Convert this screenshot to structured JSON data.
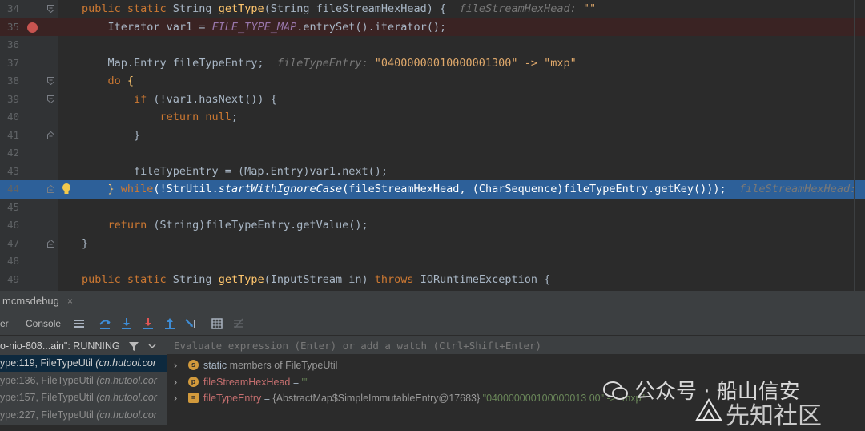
{
  "editor": {
    "lines": [
      {
        "num": "34",
        "parts": [
          [
            "kw",
            "public static "
          ],
          [
            "",
            "String "
          ],
          [
            "fn",
            "getType"
          ],
          [
            "",
            "(String fileStreamHexHead) {  "
          ],
          [
            "hint",
            "fileStreamHexHead: "
          ],
          [
            "hstr",
            "\"\""
          ]
        ]
      },
      {
        "num": "35",
        "parts": [
          [
            "",
            "Iterator var1 = "
          ],
          [
            "st",
            "FILE_TYPE_MAP"
          ],
          [
            "",
            ".entrySet().iterator();"
          ]
        ]
      },
      {
        "num": "36",
        "parts": []
      },
      {
        "num": "37",
        "parts": [
          [
            "",
            "Map.Entry fileTypeEntry;  "
          ],
          [
            "hint",
            "fileTypeEntry: "
          ],
          [
            "hstr",
            "\"04000000010000001300\" -> \"mxp\""
          ]
        ]
      },
      {
        "num": "38",
        "parts": [
          [
            "kw",
            "do "
          ],
          [
            "fn",
            "{"
          ]
        ]
      },
      {
        "num": "39",
        "parts": [
          [
            "kw",
            "if "
          ],
          [
            "",
            "(!var1.hasNext()) {"
          ]
        ]
      },
      {
        "num": "40",
        "parts": [
          [
            "kw",
            "return null"
          ],
          [
            "",
            ";"
          ]
        ]
      },
      {
        "num": "41",
        "parts": [
          [
            "",
            "}"
          ]
        ]
      },
      {
        "num": "42",
        "parts": []
      },
      {
        "num": "43",
        "parts": [
          [
            "",
            "fileTypeEntry = (Map.Entry)var1.next();"
          ]
        ]
      },
      {
        "num": "44",
        "parts": [
          [
            "fn",
            "}"
          ],
          [
            "",
            " "
          ],
          [
            "kw",
            "while"
          ],
          [
            "",
            "(!StrUtil."
          ],
          [
            "it",
            "startWithIgnoreCase"
          ],
          [
            "",
            "(fileStreamHexHead, (CharSequence)fileTypeEntry.getKey()));  "
          ],
          [
            "hint",
            "fileStreamHexHead: "
          ]
        ]
      },
      {
        "num": "45",
        "parts": []
      },
      {
        "num": "46",
        "parts": [
          [
            "kw",
            "return "
          ],
          [
            "",
            "(String)fileTypeEntry.getValue();"
          ]
        ]
      },
      {
        "num": "47",
        "parts": [
          [
            "",
            "}"
          ]
        ]
      },
      {
        "num": "48",
        "parts": []
      },
      {
        "num": "49",
        "parts": [
          [
            "kw",
            "public static "
          ],
          [
            "",
            "String "
          ],
          [
            "fn",
            "getType"
          ],
          [
            "",
            "(InputStream in) "
          ],
          [
            "kw",
            "throws "
          ],
          [
            "",
            "IORuntimeException {"
          ]
        ]
      }
    ]
  },
  "debug_panel": {
    "title": "mcmsdebug",
    "close_glyph": "×",
    "tab_partial": "er",
    "tab_console": "Console",
    "thread": "o-nio-808...ain\": RUNNING",
    "frames": [
      {
        "method": "ype:119, FileTypeUtil ",
        "pkg": "(cn.hutool.cor"
      },
      {
        "method": "ype:136, FileTypeUtil ",
        "pkg": "(cn.hutool.cor"
      },
      {
        "method": "ype:157, FileTypeUtil ",
        "pkg": "(cn.hutool.cor"
      },
      {
        "method": "ype:227, FileTypeUtil ",
        "pkg": "(cn.hutool.cor"
      }
    ],
    "eval_placeholder": "Evaluate expression (Enter) or add a watch (Ctrl+Shift+Enter)",
    "variables": [
      {
        "icon": "s",
        "icon_color": "#d29a3c",
        "label": "static",
        "rest": " members of FileTypeUtil"
      },
      {
        "icon": "p",
        "icon_color": "#d29a3c",
        "name": "fileStreamHexHead",
        "eq": " = ",
        "value": "\"\""
      },
      {
        "icon": "≡",
        "icon_color": "#d29a3c",
        "name": "fileTypeEntry",
        "eq": " = ",
        "type": "{AbstractMap$SimpleImmutableEntry@17683} ",
        "value": "\"040000000100000013 00\" -> \"mxp\""
      }
    ]
  },
  "watermark": {
    "line1": "公众号 · 船山信安",
    "line2": "先知社区"
  },
  "colors": {
    "editor_bg": "#2b2b2b",
    "current_line": "#2d6099",
    "breakpoint_line": "#3a2323",
    "keyword": "#cc7832",
    "function": "#ffc66d"
  }
}
